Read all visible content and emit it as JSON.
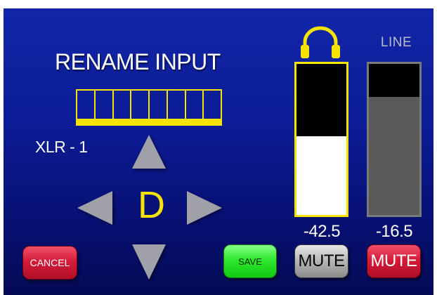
{
  "screen": {
    "title": "RENAME INPUT",
    "input_name": "XLR - 1",
    "current_char": "D",
    "char_slots": 8
  },
  "buttons": {
    "cancel_label": "CANCEL",
    "save_label": "SAVE"
  },
  "meters": {
    "headphone": {
      "icon": "headphones-icon",
      "level_text": "-42.5",
      "fill_fraction": 0.52,
      "mute_label": "MUTE",
      "muted": false,
      "accent_color": "#f5e400"
    },
    "line": {
      "label": "LINE",
      "level_text": "-16.5",
      "fill_fraction": 0.78,
      "mute_label": "MUTE",
      "muted": true,
      "accent_color": "#7a7a7a"
    }
  },
  "colors": {
    "background": "#0c1c96",
    "accent_yellow": "#f5e400",
    "cancel_red": "#d41c3a",
    "save_green": "#2ee82e",
    "arrow_gray": "#a0a0a8"
  }
}
